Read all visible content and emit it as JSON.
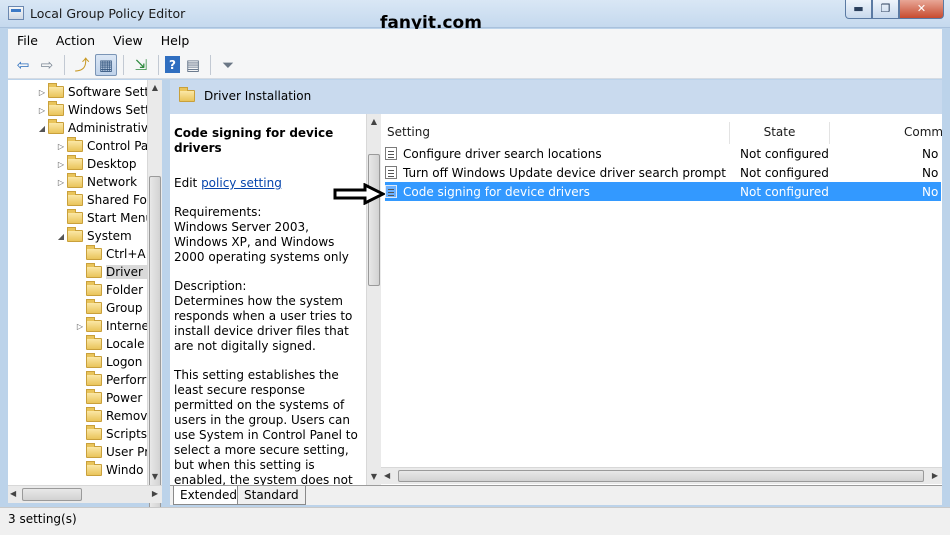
{
  "window": {
    "title": "Local Group Policy Editor",
    "watermark": "fanyit.com"
  },
  "window_buttons": {
    "minimize": "▬",
    "maximize": "❐",
    "close": "✕"
  },
  "menu": [
    "File",
    "Action",
    "View",
    "Help"
  ],
  "toolbar": {
    "icons": [
      "back-icon",
      "forward-icon",
      "up-folder-icon",
      "show-hide-tree-icon",
      "export-list-icon",
      "help-icon",
      "properties-icon",
      "filter-icon"
    ],
    "glyphs": {
      "back": "⇦",
      "forward": "⇨",
      "up": "⤴",
      "tree": "▦",
      "export": "⇲",
      "help": "?",
      "props": "▤",
      "filter": "⏷"
    }
  },
  "tree": [
    {
      "label": "Software Setti",
      "indent": 1,
      "expander": "▷"
    },
    {
      "label": "Windows Sett",
      "indent": 1,
      "expander": "▷"
    },
    {
      "label": "Administrative",
      "indent": 1,
      "expander": "◢"
    },
    {
      "label": "Control Pa",
      "indent": 2,
      "expander": "▷"
    },
    {
      "label": "Desktop",
      "indent": 2,
      "expander": "▷"
    },
    {
      "label": "Network",
      "indent": 2,
      "expander": "▷"
    },
    {
      "label": "Shared Fol",
      "indent": 2,
      "expander": ""
    },
    {
      "label": "Start Menu",
      "indent": 2,
      "expander": ""
    },
    {
      "label": "System",
      "indent": 2,
      "expander": "◢"
    },
    {
      "label": "Ctrl+A",
      "indent": 3,
      "expander": ""
    },
    {
      "label": "Driver I",
      "indent": 3,
      "expander": "",
      "selected": true
    },
    {
      "label": "Folder",
      "indent": 3,
      "expander": ""
    },
    {
      "label": "Group",
      "indent": 3,
      "expander": ""
    },
    {
      "label": "Interne",
      "indent": 3,
      "expander": "▷"
    },
    {
      "label": "Locale",
      "indent": 3,
      "expander": ""
    },
    {
      "label": "Logon",
      "indent": 3,
      "expander": ""
    },
    {
      "label": "Perforr",
      "indent": 3,
      "expander": ""
    },
    {
      "label": "Power",
      "indent": 3,
      "expander": ""
    },
    {
      "label": "Remov",
      "indent": 3,
      "expander": ""
    },
    {
      "label": "Scripts",
      "indent": 3,
      "expander": ""
    },
    {
      "label": "User Pr",
      "indent": 3,
      "expander": ""
    },
    {
      "label": "Windo",
      "indent": 3,
      "expander": ""
    }
  ],
  "header": {
    "title": "Driver Installation"
  },
  "description": {
    "title": "Code signing for device drivers",
    "edit_prefix": "Edit ",
    "edit_link": "policy setting",
    "requirements_label": "Requirements:",
    "requirements_text": "Windows Server 2003, Windows XP, and Windows 2000 operating systems only",
    "description_label": "Description:",
    "description_text": "Determines how the system responds when a user tries to install device driver files that are not digitally signed.",
    "body_text": "This setting establishes the least secure response permitted on the systems of users in the group. Users can use System in Control Panel to select a more secure setting, but when this setting is enabled, the system does not implement any setting less secure than the one the setting"
  },
  "list": {
    "columns": [
      "Setting",
      "State",
      "Comm"
    ],
    "rows": [
      {
        "setting": "Configure driver search locations",
        "state": "Not configured",
        "comment": "No"
      },
      {
        "setting": "Turn off Windows Update device driver search prompt",
        "state": "Not configured",
        "comment": "No"
      },
      {
        "setting": "Code signing for device drivers",
        "state": "Not configured",
        "comment": "No",
        "selected": true
      }
    ]
  },
  "tabs": [
    "Extended",
    "Standard"
  ],
  "status": {
    "text": "3 setting(s)"
  },
  "colors": {
    "selection": "#3399ff",
    "band": "#c9daee",
    "link": "#0645ad"
  }
}
